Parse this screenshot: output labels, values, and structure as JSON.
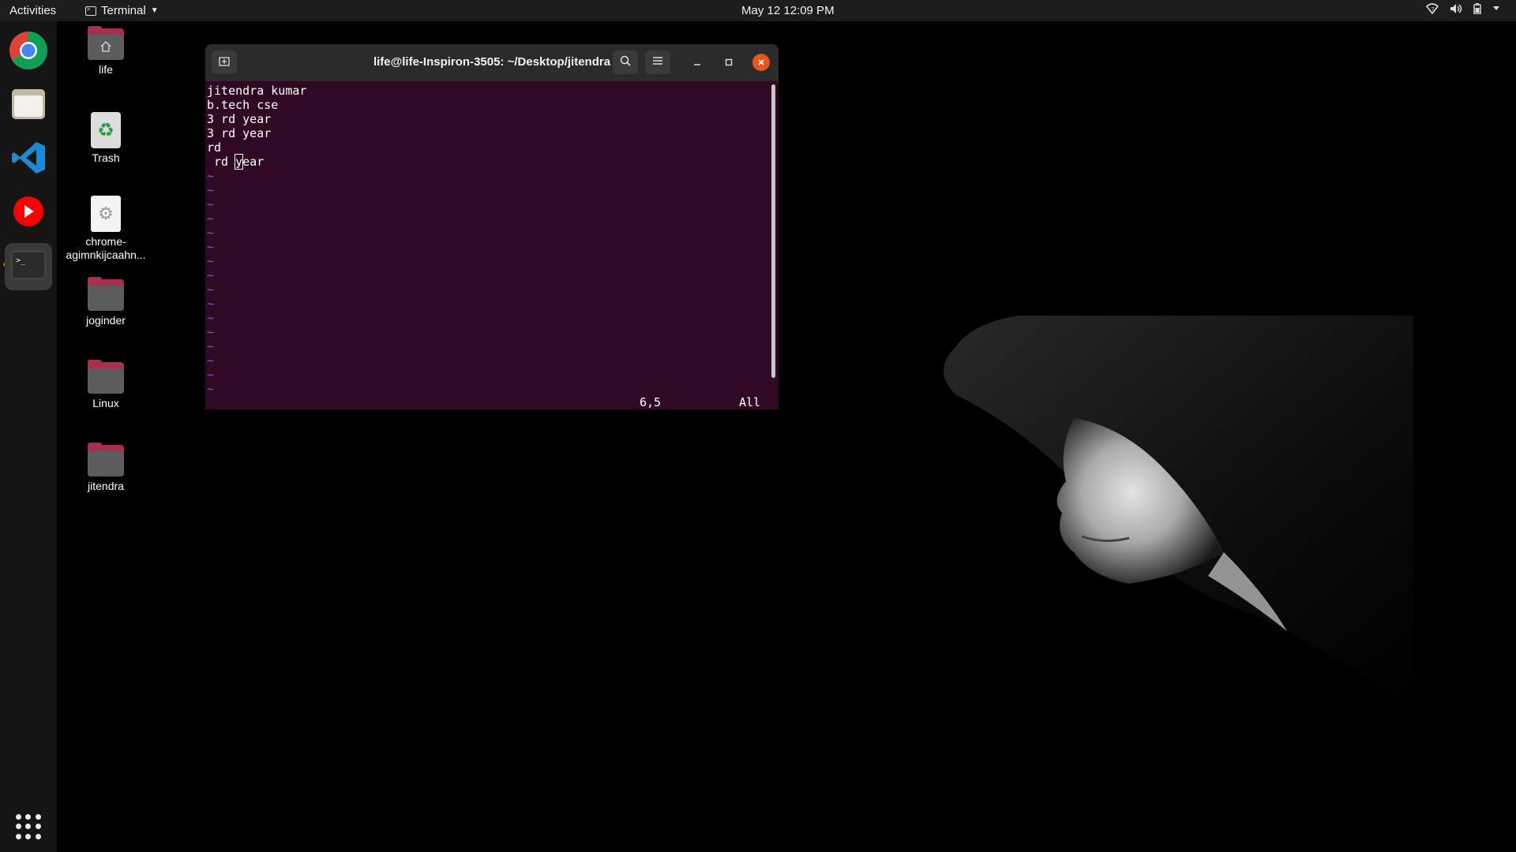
{
  "topbar": {
    "activities": "Activities",
    "app_name": "Terminal",
    "clock": "May 12  12:09 PM"
  },
  "dock": {
    "items": [
      "chrome-icon",
      "files-icon",
      "vscode-icon",
      "youtube-icon",
      "terminal-icon"
    ],
    "active": "terminal-icon"
  },
  "desktop": {
    "icons": [
      {
        "label": "life"
      },
      {
        "label": "Trash"
      },
      {
        "label": "chrome-\nagimnkijcaahn..."
      },
      {
        "label": "joginder"
      },
      {
        "label": "Linux"
      },
      {
        "label": "jitendra"
      }
    ]
  },
  "terminal": {
    "title": "life@life-Inspiron-3505: ~/Desktop/jitendra",
    "lines": [
      "jitendra kumar",
      "b.tech cse",
      "3 rd year",
      "3 rd year",
      "rd"
    ],
    "cursor_line_before": " rd ",
    "cursor_char": "y",
    "cursor_line_after": "ear",
    "tilde": "~",
    "tilde_count": 16,
    "position": "6,5",
    "scroll": "All"
  },
  "colors": {
    "terminal_bg": "#300a24",
    "accent": "#e95420",
    "tilde": "#6c5ce7"
  }
}
